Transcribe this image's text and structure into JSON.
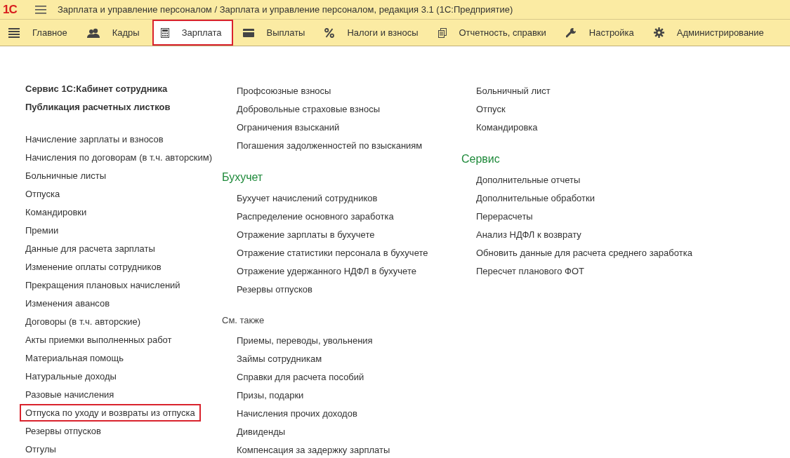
{
  "window": {
    "logo": "1С",
    "title": "Зарплата и управление персоналом / Зарплата и управление персоналом, редакция 3.1  (1С:Предприятие)"
  },
  "tabs": [
    {
      "label": "Главное",
      "selected": false
    },
    {
      "label": "Кадры",
      "selected": false
    },
    {
      "label": "Зарплата",
      "selected": true
    },
    {
      "label": "Выплаты",
      "selected": false
    },
    {
      "label": "Налоги и взносы",
      "selected": false
    },
    {
      "label": "Отчетность, справки",
      "selected": false
    },
    {
      "label": "Настройка",
      "selected": false
    },
    {
      "label": "Администрирование",
      "selected": false
    }
  ],
  "columns": [
    {
      "sections": [
        {
          "items": [
            {
              "label": "Сервис 1С:Кабинет сотрудника",
              "bold": true,
              "highlighted": false
            },
            {
              "label": "Публикация расчетных листков",
              "bold": true,
              "highlighted": false
            }
          ]
        },
        {
          "items": [
            {
              "label": "Начисление зарплаты и взносов",
              "bold": false,
              "highlighted": false
            },
            {
              "label": "Начисления по договорам (в т.ч. авторским)",
              "bold": false,
              "highlighted": false
            },
            {
              "label": "Больничные листы",
              "bold": false,
              "highlighted": false
            },
            {
              "label": "Отпуска",
              "bold": false,
              "highlighted": false
            },
            {
              "label": "Командировки",
              "bold": false,
              "highlighted": false
            },
            {
              "label": "Премии",
              "bold": false,
              "highlighted": false
            },
            {
              "label": "Данные для расчета зарплаты",
              "bold": false,
              "highlighted": false
            },
            {
              "label": "Изменение оплаты сотрудников",
              "bold": false,
              "highlighted": false
            },
            {
              "label": "Прекращения плановых начислений",
              "bold": false,
              "highlighted": false
            },
            {
              "label": "Изменения авансов",
              "bold": false,
              "highlighted": false
            },
            {
              "label": "Договоры (в т.ч. авторские)",
              "bold": false,
              "highlighted": false
            },
            {
              "label": "Акты приемки выполненных работ",
              "bold": false,
              "highlighted": false
            },
            {
              "label": "Материальная помощь",
              "bold": false,
              "highlighted": false
            },
            {
              "label": "Натуральные доходы",
              "bold": false,
              "highlighted": false
            },
            {
              "label": "Разовые начисления",
              "bold": false,
              "highlighted": false
            },
            {
              "label": "Отпуска по уходу и возвраты из отпуска",
              "bold": false,
              "highlighted": true
            },
            {
              "label": "Резервы отпусков",
              "bold": false,
              "highlighted": false
            },
            {
              "label": "Отгулы",
              "bold": false,
              "highlighted": false
            }
          ]
        }
      ]
    },
    {
      "sections": [
        {
          "items": [
            {
              "label": "Профсоюзные взносы",
              "bold": false,
              "highlighted": false
            },
            {
              "label": "Добровольные страховые взносы",
              "bold": false,
              "highlighted": false
            },
            {
              "label": "Ограничения взысканий",
              "bold": false,
              "highlighted": false
            },
            {
              "label": "Погашения задолженностей по взысканиям",
              "bold": false,
              "highlighted": false
            }
          ]
        },
        {
          "heading": "Бухучет",
          "kind": "major",
          "items": [
            {
              "label": "Бухучет начислений сотрудников",
              "bold": false,
              "highlighted": false
            },
            {
              "label": "Распределение основного заработка",
              "bold": false,
              "highlighted": false
            },
            {
              "label": "Отражение зарплаты в бухучете",
              "bold": false,
              "highlighted": false
            },
            {
              "label": "Отражение статистики персонала в бухучете",
              "bold": false,
              "highlighted": false
            },
            {
              "label": "Отражение удержанного НДФЛ в бухучете",
              "bold": false,
              "highlighted": false
            },
            {
              "label": "Резервы отпусков",
              "bold": false,
              "highlighted": false
            }
          ]
        },
        {
          "heading": "См. также",
          "kind": "minor",
          "items": [
            {
              "label": "Приемы, переводы, увольнения",
              "bold": false,
              "highlighted": false
            },
            {
              "label": "Займы сотрудникам",
              "bold": false,
              "highlighted": false
            },
            {
              "label": "Справки для расчета пособий",
              "bold": false,
              "highlighted": false
            },
            {
              "label": "Призы, подарки",
              "bold": false,
              "highlighted": false
            },
            {
              "label": "Начисления прочих доходов",
              "bold": false,
              "highlighted": false
            },
            {
              "label": "Дивиденды",
              "bold": false,
              "highlighted": false
            },
            {
              "label": "Компенсация за задержку зарплаты",
              "bold": false,
              "highlighted": false
            }
          ]
        }
      ]
    },
    {
      "sections": [
        {
          "items": [
            {
              "label": "Больничный лист",
              "bold": false,
              "highlighted": false
            },
            {
              "label": "Отпуск",
              "bold": false,
              "highlighted": false
            },
            {
              "label": "Командировка",
              "bold": false,
              "highlighted": false
            }
          ]
        },
        {
          "heading": "Сервис",
          "kind": "major",
          "items": [
            {
              "label": "Дополнительные отчеты",
              "bold": false,
              "highlighted": false
            },
            {
              "label": "Дополнительные обработки",
              "bold": false,
              "highlighted": false
            },
            {
              "label": "Перерасчеты",
              "bold": false,
              "highlighted": false
            },
            {
              "label": "Анализ НДФЛ к возврату",
              "bold": false,
              "highlighted": false
            },
            {
              "label": "Обновить данные для расчета среднего заработка",
              "bold": false,
              "highlighted": false
            },
            {
              "label": "Пересчет планового ФОТ",
              "bold": false,
              "highlighted": false
            }
          ]
        }
      ]
    }
  ]
}
